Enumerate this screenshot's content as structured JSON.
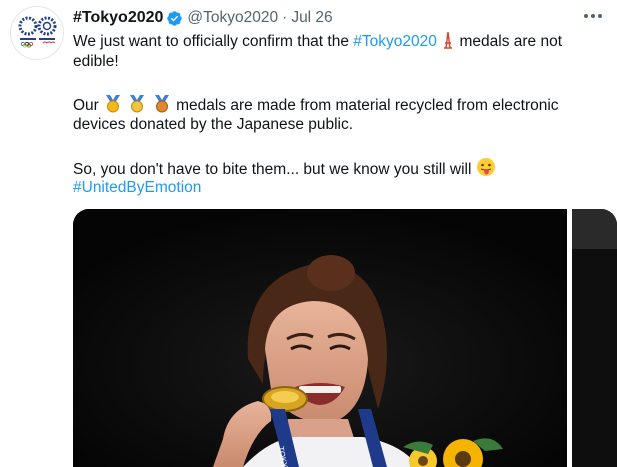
{
  "tweet": {
    "display_name": "#Tokyo2020",
    "handle": "@Tokyo2020",
    "separator": "·",
    "date": "Jul 26",
    "line1_prefix": "We just want to officially confirm that the ",
    "line1_hashtag": "#Tokyo2020",
    "line1_suffix": " medals are not",
    "line2": "edible!",
    "para2_prefix": "Our ",
    "para2_suffix": " medals are made from material recycled from electronic",
    "para2_line2": "devices donated by the Japanese public.",
    "para3": "So, you don't have to bite them... but we know you still will",
    "hashtag2": "#UnitedByEmotion",
    "avatar_icon": "olympic-paralympic-emblem-icon",
    "verified_icon": "verified-badge-icon",
    "tower_icon": "tokyo-tower-emoji",
    "medal_icons": [
      "gold-medal-emoji",
      "silver-medal-emoji",
      "bronze-medal-emoji"
    ],
    "tongue_icon": "face-with-tongue-emoji",
    "more_icon": "more-options-icon",
    "accent_color": "#1d9bf0",
    "photo": {
      "description_icon": "athlete-biting-gold-medal-photo",
      "lanyard_text": "TOKYO"
    }
  }
}
